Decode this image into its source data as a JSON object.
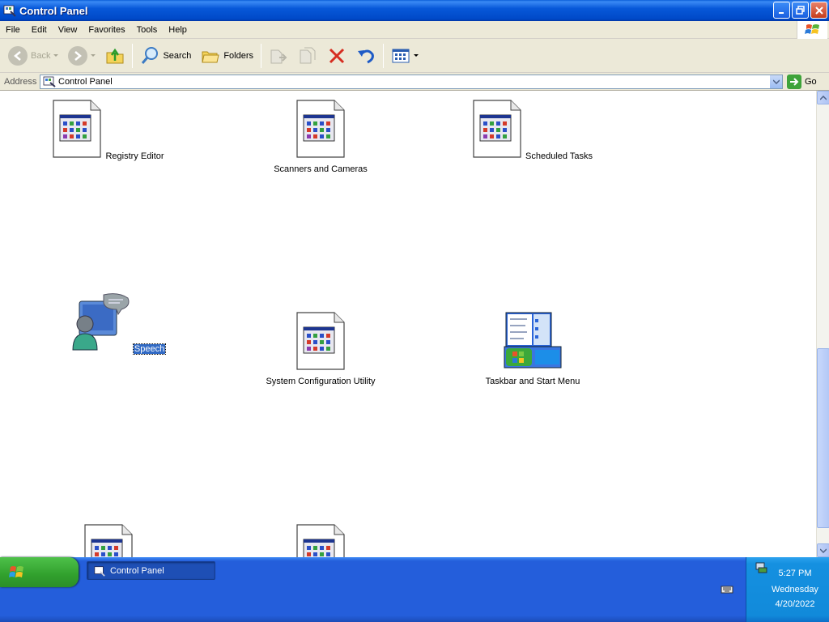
{
  "window": {
    "title": "Control Panel",
    "icon": "control-panel-icon"
  },
  "menu": [
    "File",
    "Edit",
    "View",
    "Favorites",
    "Tools",
    "Help"
  ],
  "toolbar": {
    "back_label": "Back",
    "search_label": "Search",
    "folders_label": "Folders"
  },
  "address": {
    "label": "Address",
    "value": "Control Panel",
    "go_label": "Go"
  },
  "items": [
    {
      "label": "Registry Editor",
      "icon": "generic-app-icon",
      "selected": false
    },
    {
      "label": "Scanners and Cameras",
      "icon": "generic-app-icon",
      "selected": false
    },
    {
      "label": "Scheduled Tasks",
      "icon": "generic-app-icon",
      "selected": false
    },
    {
      "label": "Speech",
      "icon": "speech-icon",
      "selected": true
    },
    {
      "label": "System Configuration Utility",
      "icon": "generic-app-icon",
      "selected": false
    },
    {
      "label": "Taskbar and Start Menu",
      "icon": "taskbar-icon",
      "selected": false
    }
  ],
  "taskbar": {
    "task_label": "Control Panel",
    "clock_time": "5:27 PM",
    "clock_day": "Wednesday",
    "clock_date": "4/20/2022"
  },
  "colors": {
    "titlebar": "#0758d9",
    "taskbar": "#245edb",
    "start": "#31a02d",
    "selection": "#316ac5"
  }
}
